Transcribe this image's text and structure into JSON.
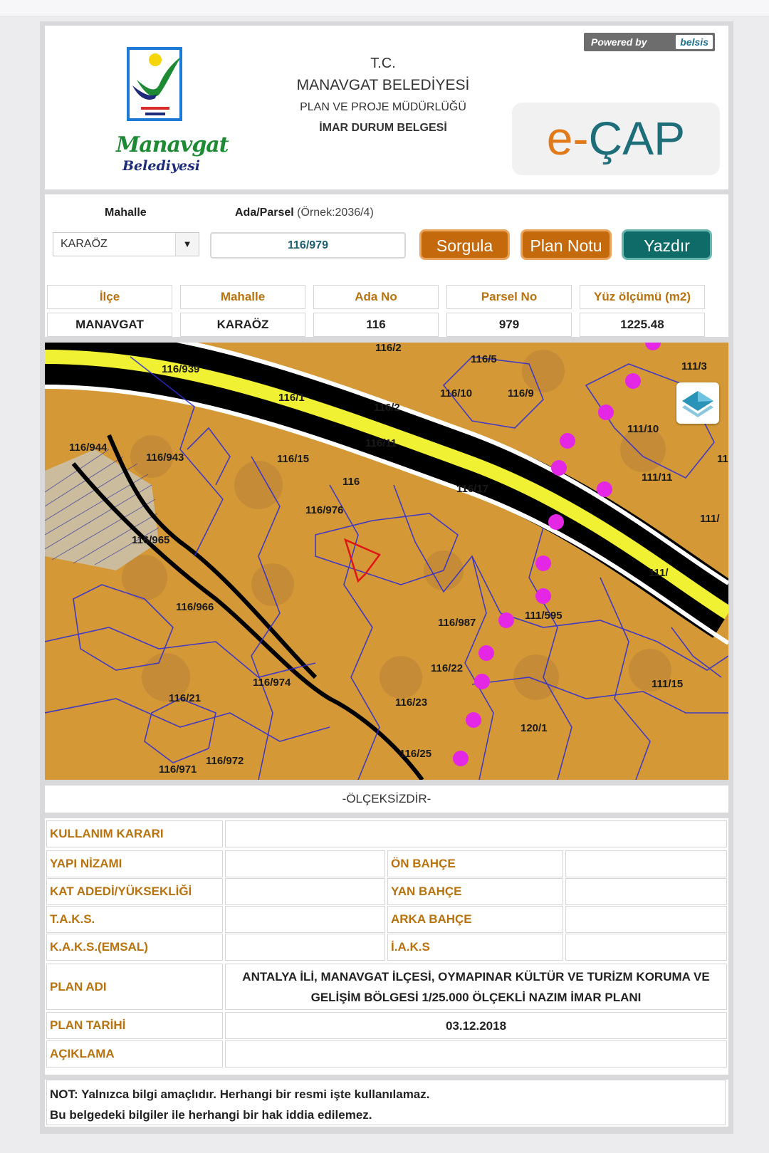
{
  "header": {
    "logo_text_1": "Manavgat",
    "logo_text_2": "Belediyesi",
    "line_1": "T.C.",
    "line_2": "MANAVGAT BELEDİYESİ",
    "line_3": "PLAN VE PROJE MÜDÜRLÜĞÜ",
    "line_4": "İMAR DURUM BELGESİ",
    "powered_by": "Powered by",
    "powered_brand": "belsis",
    "app_logo_e": "e-",
    "app_logo_cap": "ÇAP"
  },
  "search": {
    "mahalle_label": "Mahalle",
    "ada_parsel_label": "Ada/Parsel",
    "ada_parsel_hint": "(Örnek:2036/4)",
    "mahalle_selected": "KARAÖZ",
    "ada_parsel_value": "116/979",
    "sorgula_label": "Sorgula",
    "plan_notu_label": "Plan Notu",
    "yazdir_label": "Yazdır"
  },
  "parcel_info": {
    "headers": [
      "İlçe",
      "Mahalle",
      "Ada No",
      "Parsel No",
      "Yüz ölçümü (m2)"
    ],
    "values": [
      "MANAVGAT",
      "KARAÖZ",
      "116",
      "979",
      "1225.48"
    ]
  },
  "map": {
    "parcel_labels": [
      "116/2",
      "116/5",
      "111/3",
      "116/939",
      "116/10",
      "116/9",
      "116/1",
      "116/2",
      "111/10",
      "116/944",
      "116/943",
      "116/11",
      "116/15",
      "111/11",
      "116",
      "116/17",
      "111/",
      "116/976",
      "116/965",
      "111/",
      "116/966",
      "116/987",
      "111/595",
      "116/22",
      "111/15",
      "116/974",
      "116/21",
      "116/23",
      "120/1",
      "116/25",
      "116/972",
      "116/971",
      "11"
    ]
  },
  "scale_note": "-ÖLÇEKSİZDİR-",
  "zoning": {
    "kullanim_karari": "KULLANIM KARARI",
    "yapi_nizami": "YAPI NİZAMI",
    "on_bahce": "ÖN BAHÇE",
    "kat_adedi": "KAT ADEDİ/YÜKSEKLİĞİ",
    "yan_bahce": "YAN BAHÇE",
    "taks": "T.A.K.S.",
    "arka_bahce": "ARKA BAHÇE",
    "kaks": "K.A.K.S.(EMSAL)",
    "iaks": "İ.A.K.S",
    "plan_adi_label": "PLAN ADI",
    "plan_adi_value": "ANTALYA İLİ, MANAVGAT İLÇESİ, OYMAPINAR KÜLTÜR VE TURİZM KORUMA VE GELİŞİM BÖLGESİ 1/25.000 ÖLÇEKLİ NAZIM İMAR PLANI",
    "plan_tarihi_label": "PLAN TARİHİ",
    "plan_tarihi_value": "03.12.2018",
    "aciklama_label": "AÇIKLAMA"
  },
  "note": {
    "line_1": "NOT: Yalnızca bilgi amaçlıdır. Herhangi bir resmi işte kullanılamaz.",
    "line_2": "Bu belgedeki bilgiler ile herhangi bir hak iddia edilemez."
  },
  "colors": {
    "accent_orange": "#c56a0c",
    "accent_teal": "#0e6b68",
    "label_gold": "#b8720e"
  }
}
